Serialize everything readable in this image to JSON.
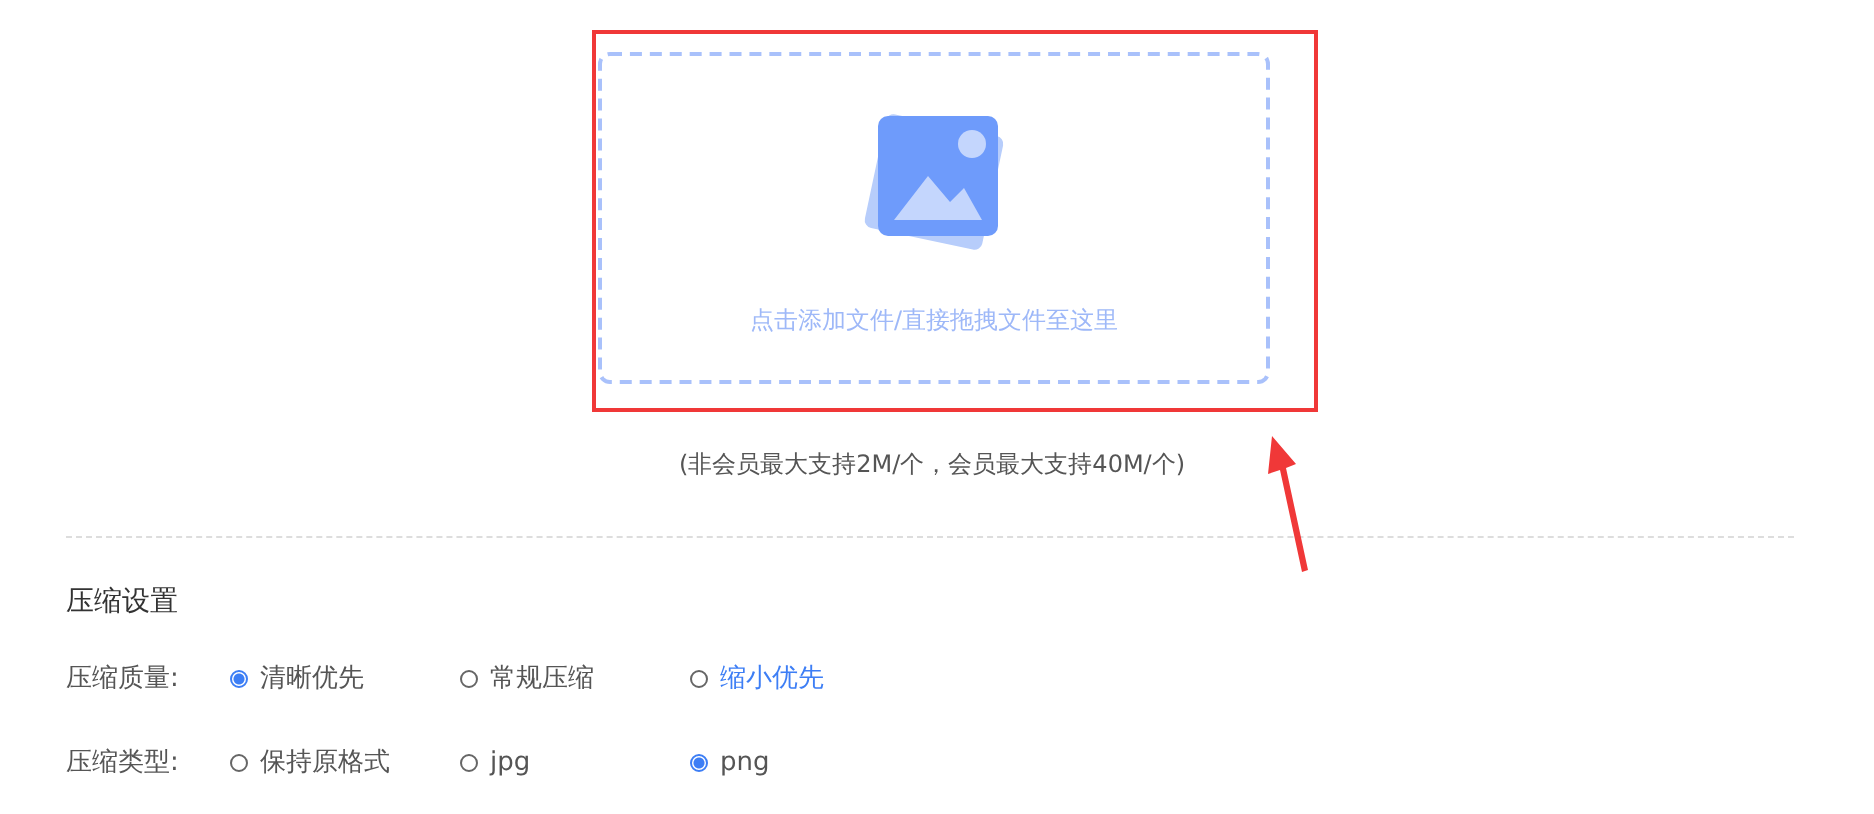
{
  "upload": {
    "hint": "点击添加文件/直接拖拽文件至这里",
    "highlighted": true
  },
  "size_note": "(非会员最大支持2M/个，会员最大支持40M/个)",
  "settings": {
    "title": "压缩设置",
    "groups": [
      {
        "label": "压缩质量:",
        "options": [
          {
            "label": "清晰优先",
            "selected": true,
            "highlighted": false
          },
          {
            "label": "常规压缩",
            "selected": false,
            "highlighted": false
          },
          {
            "label": "缩小优先",
            "selected": false,
            "highlighted": true
          }
        ]
      },
      {
        "label": "压缩类型:",
        "options": [
          {
            "label": "保持原格式",
            "selected": false,
            "highlighted": false
          },
          {
            "label": "jpg",
            "selected": false,
            "highlighted": false
          },
          {
            "label": "png",
            "selected": true,
            "highlighted": false
          }
        ]
      }
    ]
  }
}
